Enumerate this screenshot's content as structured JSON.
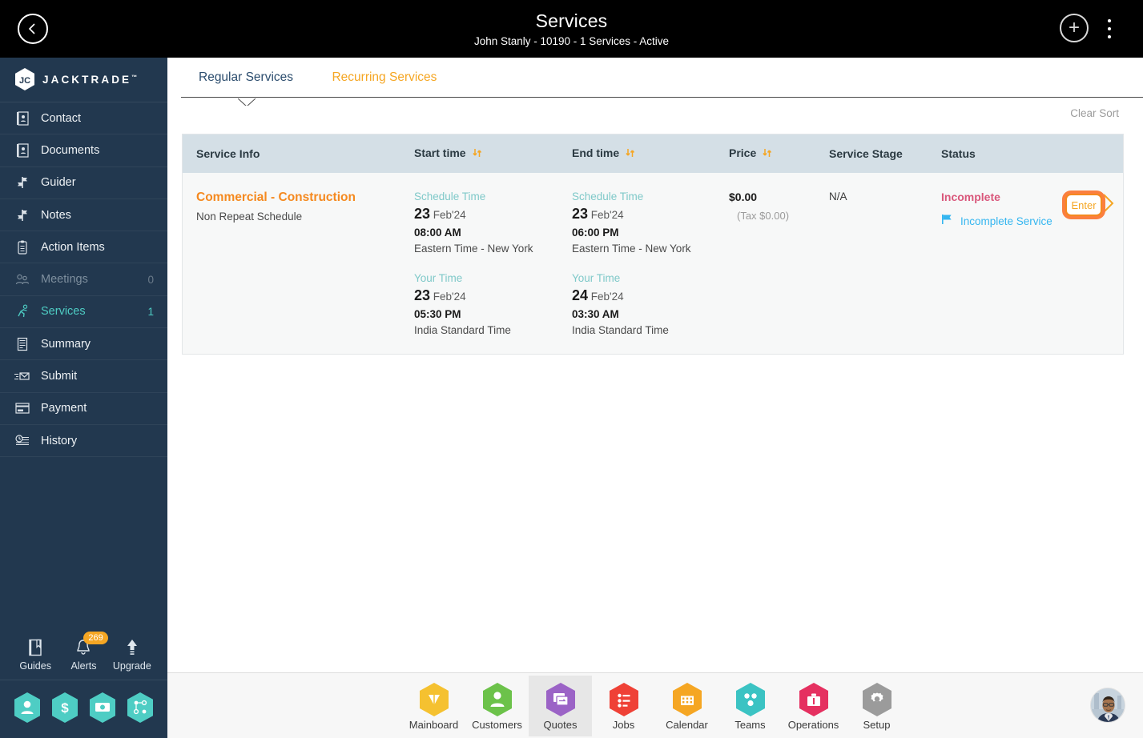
{
  "topbar": {
    "back_icon": "chevron-left-icon",
    "title": "Services",
    "subtitle": "John Stanly - 10190 - 1 Services - Active",
    "add_icon": "plus-icon",
    "menu_icon": "kebab-menu-icon"
  },
  "sidebar": {
    "logo_text": "JACKTRADE",
    "logo_tm": "™",
    "items": [
      {
        "label": "Contact",
        "icon": "contact-card-icon",
        "count": ""
      },
      {
        "label": "Documents",
        "icon": "documents-icon",
        "count": ""
      },
      {
        "label": "Guider",
        "icon": "signpost-icon",
        "count": ""
      },
      {
        "label": "Notes",
        "icon": "notes-icon",
        "count": ""
      },
      {
        "label": "Action Items",
        "icon": "clipboard-icon",
        "count": ""
      },
      {
        "label": "Meetings",
        "icon": "meetings-icon",
        "count": "0"
      },
      {
        "label": "Services",
        "icon": "services-icon",
        "count": "1"
      },
      {
        "label": "Summary",
        "icon": "summary-icon",
        "count": ""
      },
      {
        "label": "Submit",
        "icon": "submit-mail-icon",
        "count": ""
      },
      {
        "label": "Payment",
        "icon": "payment-card-icon",
        "count": ""
      },
      {
        "label": "History",
        "icon": "history-clock-icon",
        "count": ""
      }
    ],
    "active_index": 6,
    "dim_index": 5,
    "tools": [
      {
        "label": "Guides",
        "icon": "book-icon",
        "badge": ""
      },
      {
        "label": "Alerts",
        "icon": "bell-icon",
        "badge": "269"
      },
      {
        "label": "Upgrade",
        "icon": "arrow-up-icon",
        "badge": ""
      }
    ],
    "quick_hexes": [
      {
        "icon": "person-hex-icon"
      },
      {
        "icon": "dollar-hex-icon"
      },
      {
        "icon": "money-transfer-hex-icon"
      },
      {
        "icon": "workflow-hex-icon"
      }
    ]
  },
  "tabs": [
    {
      "label": "Regular Services",
      "active": true
    },
    {
      "label": "Recurring Services",
      "active": false
    }
  ],
  "toolbar": {
    "clear_sort_label": "Clear Sort"
  },
  "table": {
    "columns": [
      {
        "label": "Service Info",
        "sortable": false
      },
      {
        "label": "Start time",
        "sortable": true
      },
      {
        "label": "End time",
        "sortable": true
      },
      {
        "label": "Price",
        "sortable": true
      },
      {
        "label": "Service Stage",
        "sortable": false
      },
      {
        "label": "Status",
        "sortable": false
      }
    ],
    "rows": [
      {
        "service_title": "Commercial - Construction",
        "service_sub": "Non Repeat Schedule",
        "start": {
          "schedule": {
            "label": "Schedule Time",
            "day": "23",
            "monthyear": "Feb'24",
            "time": "08:00 AM",
            "zone": "Eastern Time - New York"
          },
          "your": {
            "label": "Your Time",
            "day": "23",
            "monthyear": "Feb'24",
            "time": "05:30 PM",
            "zone": "India Standard Time"
          }
        },
        "end": {
          "schedule": {
            "label": "Schedule Time",
            "day": "23",
            "monthyear": "Feb'24",
            "time": "06:00 PM",
            "zone": "Eastern Time - New York"
          },
          "your": {
            "label": "Your Time",
            "day": "24",
            "monthyear": "Feb'24",
            "time": "03:30 AM",
            "zone": "India Standard Time"
          }
        },
        "price": "$0.00",
        "price_tax": "(Tax $0.00)",
        "service_stage": "N/A",
        "status": "Incomplete",
        "status_note": "Incomplete Service",
        "status_flag_icon": "flag-icon",
        "enter_label": "Enter",
        "enter_chevron_icon": "chevron-right-icon"
      }
    ]
  },
  "bottom_nav": {
    "items": [
      {
        "label": "Mainboard",
        "icon": "mainboard-hex-icon",
        "color": "#f5c130",
        "selected": false
      },
      {
        "label": "Customers",
        "icon": "customers-hex-icon",
        "color": "#6cc24a",
        "selected": false
      },
      {
        "label": "Quotes",
        "icon": "quotes-hex-icon",
        "color": "#9b63c6",
        "selected": true
      },
      {
        "label": "Jobs",
        "icon": "jobs-hex-icon",
        "color": "#ef4136",
        "selected": false
      },
      {
        "label": "Calendar",
        "icon": "calendar-hex-icon",
        "color": "#f5a623",
        "selected": false
      },
      {
        "label": "Teams",
        "icon": "teams-hex-icon",
        "color": "#3bc3c3",
        "selected": false
      },
      {
        "label": "Operations",
        "icon": "operations-hex-icon",
        "color": "#e53060",
        "selected": false
      },
      {
        "label": "Setup",
        "icon": "setup-hex-icon",
        "color": "#9b9b9b",
        "selected": false
      }
    ],
    "avatar_icon": "user-avatar"
  },
  "colors": {
    "sidebar_bg": "#22384f",
    "accent_orange": "#f5891f",
    "accent_teal": "#4ecdc4",
    "table_header_bg": "#d4dfe6",
    "status_incomplete": "#d9577b",
    "link_blue": "#35b6f0",
    "highlight_ring": "#fb7f3f"
  }
}
